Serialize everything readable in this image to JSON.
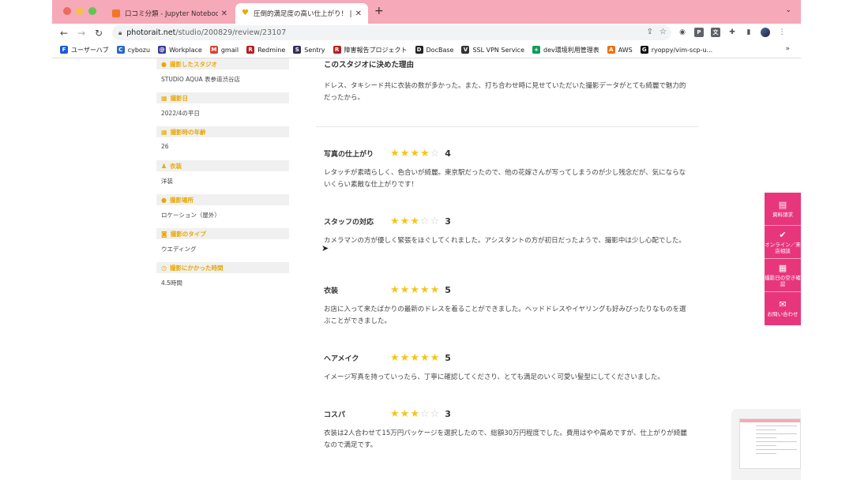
{
  "browser": {
    "tabs": [
      {
        "label": "口コミ分類 - Jupyter Notebook",
        "favicon": "jupyter-icon",
        "active": false
      },
      {
        "label": "圧倒的満足度の高い仕上がり！ | し",
        "favicon": "heart-icon",
        "active": true
      }
    ],
    "new_tab": "+",
    "tab_menu": "⌄",
    "url_host": "photorait.net",
    "url_path": "/studio/200829/review/23107",
    "bookmarks": [
      {
        "label": "ユーザーハブ",
        "icon": "F",
        "color": "#1a5bd6"
      },
      {
        "label": "cybozu",
        "icon": "C",
        "color": "#2a6ac6"
      },
      {
        "label": "Workplace",
        "icon": "@",
        "color": "#3b3b98"
      },
      {
        "label": "gmail",
        "icon": "M",
        "color": "#d44638"
      },
      {
        "label": "Redmine",
        "icon": "R",
        "color": "#b32024"
      },
      {
        "label": "Sentry",
        "icon": "S",
        "color": "#362d59"
      },
      {
        "label": "障害報告プロジェクト",
        "icon": "R",
        "color": "#b32024"
      },
      {
        "label": "DocBase",
        "icon": "D",
        "color": "#222222"
      },
      {
        "label": "SSL VPN Service",
        "icon": "V",
        "color": "#333333"
      },
      {
        "label": "dev環境利用管理表",
        "icon": "+",
        "color": "#0f9d58"
      },
      {
        "label": "AWS",
        "icon": "A",
        "color": "#ec7211"
      },
      {
        "label": "ryoppy/vim-scp-u...",
        "icon": "G",
        "color": "#111111"
      }
    ],
    "bookmarks_more": "»"
  },
  "sidebar": [
    {
      "heading": "撮影したスタジオ",
      "value": "STUDIO AQUA 表参道渋谷店",
      "icon": "pin-icon"
    },
    {
      "heading": "撮影日",
      "value": "2022/4の平日",
      "icon": "calendar-icon"
    },
    {
      "heading": "撮影時の年齢",
      "value": "26",
      "icon": "calendar-icon"
    },
    {
      "heading": "衣装",
      "value": "洋装",
      "icon": "dress-icon"
    },
    {
      "heading": "撮影場所",
      "value": "ロケーション（屋外）",
      "icon": "pin-icon"
    },
    {
      "heading": "撮影のタイプ",
      "value": "ウエディング",
      "icon": "camera-icon"
    },
    {
      "heading": "撮影にかかった時間",
      "value": "4.5時間",
      "icon": "clock-icon"
    }
  ],
  "reason": {
    "title": "このスタジオに決めた理由",
    "text": "ドレス、タキシード共に衣装の数が多かった。また、打ち合わせ時に見せていただいた撮影データがとても綺麗で魅力的だったから。"
  },
  "ratings": [
    {
      "label": "写真の仕上がり",
      "score": 4,
      "score_text": "4",
      "text": "レタッチが素晴らしく、色合いが綺麗。東京駅だったので、他の花嫁さんが写ってしまうのが少し残念だが、気にならないくらい素敵な仕上がりです！"
    },
    {
      "label": "スタッフの対応",
      "score": 3,
      "score_text": "3",
      "text": "カメラマンの方が優しく緊張をほぐしてくれました。アシスタントの方が初日だったようで、撮影中は少し心配でした。"
    },
    {
      "label": "衣装",
      "score": 5,
      "score_text": "5",
      "text": "お店に入って来たばかりの最新のドレスを着ることができました。ヘッドドレスやイヤリングも好みぴったりなものを選ぶことができました。"
    },
    {
      "label": "ヘアメイク",
      "score": 5,
      "score_text": "5",
      "text": "イメージ写真を持っていったら、丁寧に確認してくださり、とても満足のいく可愛い髪型にしてくださいました。"
    },
    {
      "label": "コスパ",
      "score": 3,
      "score_text": "3",
      "text": "衣装は2人合わせて15万円パッケージを選択したので、総額30万円程度でした。費用はやや高めですが、仕上がりが綺麗なので満足です。"
    }
  ],
  "float_buttons": [
    {
      "label": "資料請求",
      "icon": "document-icon"
    },
    {
      "label": "オンライン／来店相談",
      "icon": "check-icon"
    },
    {
      "label": "撮影日の空き確認",
      "icon": "calendar-icon"
    },
    {
      "label": "お問い合わせ",
      "icon": "mail-icon"
    }
  ],
  "colors": {
    "tab_strip": "#f6a9b8",
    "accent_yellow": "#e8a800",
    "star": "#f5c518",
    "float_pink": "#e8367c"
  }
}
